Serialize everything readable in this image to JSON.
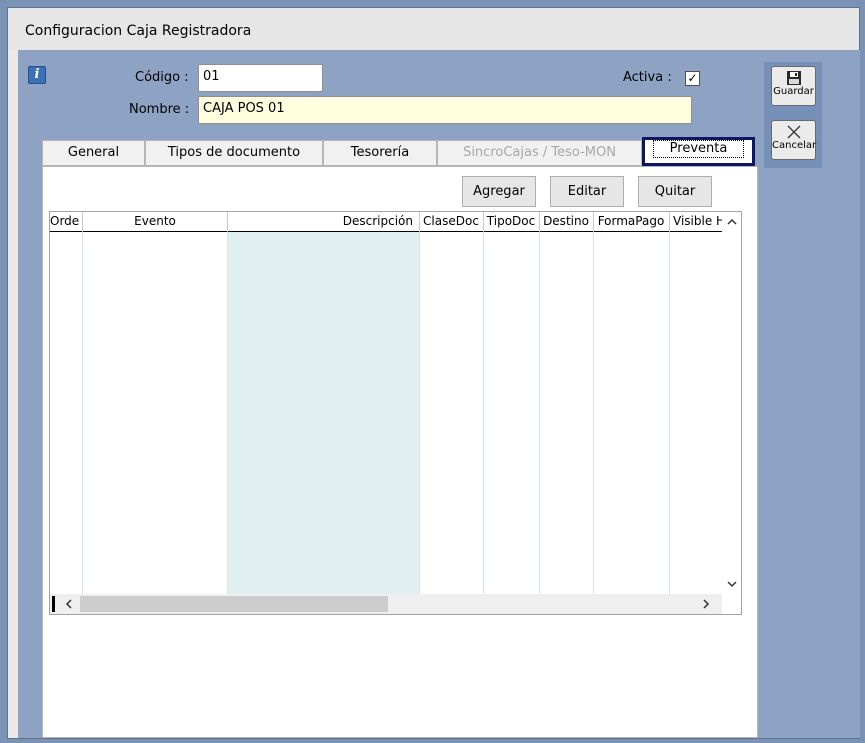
{
  "window": {
    "title": "Configuracion  Caja  Registradora"
  },
  "header": {
    "info_icon": "i",
    "codigo_label": "Código :",
    "codigo_value": "01",
    "nombre_label": "Nombre :",
    "nombre_value": "CAJA POS 01",
    "activa_label": "Activa :",
    "activa_mark": "✓",
    "activa_checked": true
  },
  "tabs": [
    {
      "label": "General",
      "state": "normal"
    },
    {
      "label": "Tipos de documento",
      "state": "normal"
    },
    {
      "label": "Tesorería",
      "state": "normal"
    },
    {
      "label": "SincroCajas / Teso-MON",
      "state": "disabled"
    },
    {
      "label": "Preventa",
      "state": "active"
    }
  ],
  "toolbar": {
    "agregar": "Agregar",
    "editar": "Editar",
    "quitar": "Quitar"
  },
  "grid": {
    "columns": [
      "Orde",
      "Evento",
      "Descripción",
      "ClaseDoc",
      "TipoDoc",
      "Destino",
      "FormaPago",
      "Visible H"
    ],
    "rows": []
  },
  "sidebar": {
    "guardar": "Guardar",
    "cancelar": "Cancelar"
  },
  "icons": {
    "info": "info-icon",
    "save": "floppy-disk-icon",
    "cancel": "cross-icon",
    "scroll_up": "chevron-up-icon",
    "scroll_down": "chevron-down-icon",
    "scroll_left": "chevron-left-icon",
    "scroll_right": "chevron-right-icon"
  },
  "colors": {
    "accent_tab_border": "#0b1560",
    "client_bg": "#8ea3c4",
    "description_column": "#e0efef",
    "name_field_bg": "#ffffe0"
  }
}
